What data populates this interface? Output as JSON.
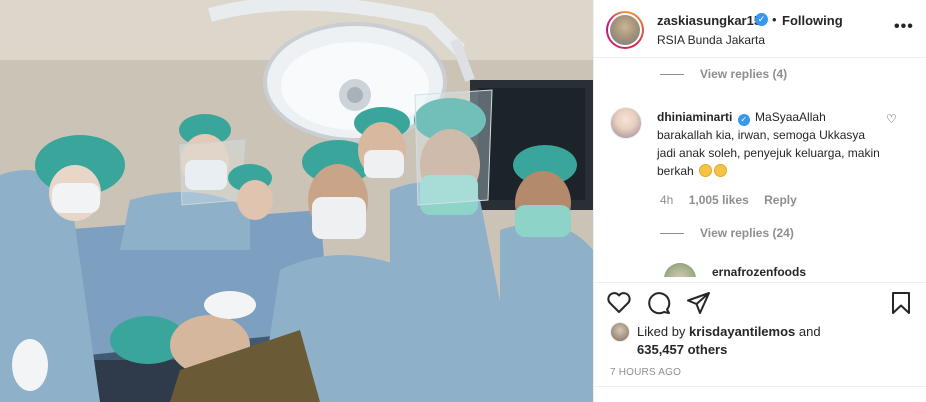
{
  "post": {
    "username": "zaskiasungkar15",
    "verified_mark": "✓",
    "separator": "•",
    "follow_status": "Following",
    "location": "RSIA Bunda Jakarta",
    "more_icon": "more-options-icon",
    "more_glyph": "•••"
  },
  "comments": {
    "view_replies_top": "View replies (4)",
    "main": {
      "user": "dhiniaminarti",
      "verified_mark": "✓",
      "text": "MaSyaaAllah barakallah kia, irwan, semoga Ukkasya jadi anak soleh, penyejuk keluarga, makin berkah",
      "age": "4h",
      "likes": "1,005 likes",
      "reply": "Reply",
      "heart_glyph": "♡"
    },
    "view_replies_bottom": "View replies (24)",
    "next_user": "ernafrozenfoods"
  },
  "actions": {
    "like_icon": "heart-icon",
    "comment_icon": "comment-icon",
    "share_icon": "share-icon",
    "save_icon": "bookmark-icon"
  },
  "likes": {
    "prefix": "Liked by",
    "user": "krisdayantilemos",
    "and": "and",
    "count": "635,457 others"
  },
  "timestamp": "7 HOURS AGO",
  "colors": {
    "text": "#262626",
    "muted": "#8e8e8e",
    "verified": "#3897f0",
    "border": "#efefef",
    "scrubs": "#8fb0c9",
    "caps": "#3aa59a"
  }
}
